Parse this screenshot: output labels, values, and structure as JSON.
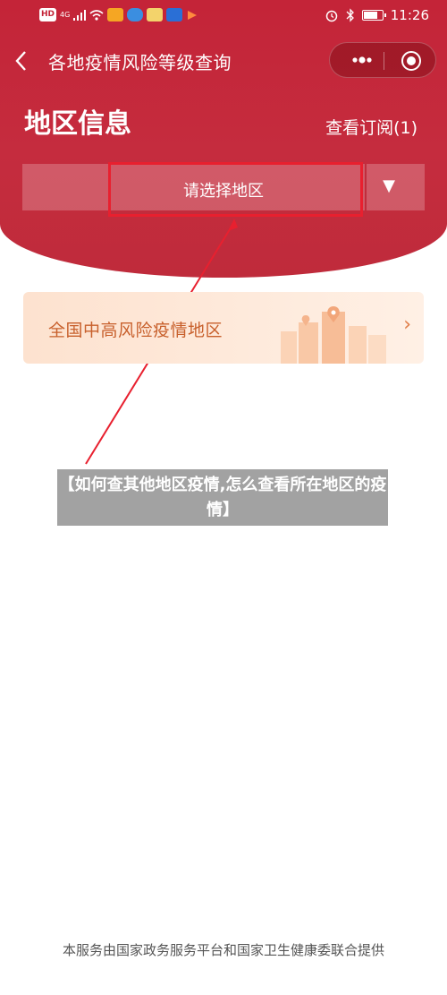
{
  "status_bar": {
    "time": "11:26",
    "left_icons": [
      "HD",
      "4G",
      "signal-icon",
      "wifi-icon",
      "app-icon-1",
      "app-icon-2",
      "app-icon-3",
      "app-icon-4",
      "app-icon-5"
    ],
    "right_icons": [
      "alarm-icon",
      "bluetooth-icon",
      "battery-icon"
    ],
    "battery_level": 0.8
  },
  "nav": {
    "back_icon": "chevron-left-icon",
    "title": "各地疫情风险等级查询",
    "more_icon": "more-dots-icon",
    "close_icon": "target-circle-icon"
  },
  "region": {
    "title": "地区信息",
    "subscribe_link": "查看订阅(1)"
  },
  "selector": {
    "placeholder": "请选择地区",
    "arrow": "▼"
  },
  "risk_card": {
    "label": "全国中高风险疫情地区",
    "chevron": "›",
    "illustration": "buildings-illustration"
  },
  "overlay": {
    "caption": "【如何查其他地区疫情,怎么查看所在地区的疫情】"
  },
  "footer": {
    "text": "本服务由国家政务服务平台和国家卫生健康委联合提供"
  },
  "colors": {
    "header_red": "#c42438",
    "annotation_red": "#e8202f",
    "card_orange_text": "#c8602c",
    "card_bg": "#fde2cf"
  }
}
